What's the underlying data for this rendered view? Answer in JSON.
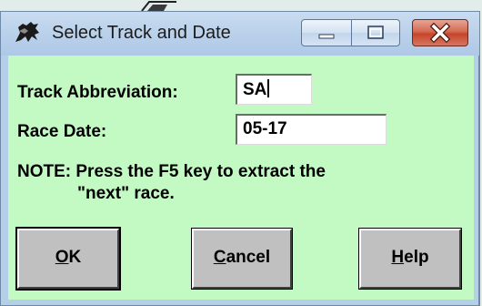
{
  "window": {
    "title": "Select Track and Date",
    "icon": "horse-icon",
    "controls": [
      "minimize",
      "maximize",
      "close"
    ]
  },
  "form": {
    "track_label": "Track Abbreviation:",
    "track_value": "SA",
    "date_label": "Race Date:",
    "date_value": "05-17",
    "note_line1": "NOTE: Press the F5 key to extract the",
    "note_line2": "\"next\" race."
  },
  "buttons": {
    "ok": {
      "mnemonic": "O",
      "rest": "K"
    },
    "cancel": {
      "mnemonic": "C",
      "rest": "ancel"
    },
    "help": {
      "mnemonic": "H",
      "rest": "elp"
    }
  },
  "colors": {
    "client_background": "#c3f9c3",
    "close_button": "#c6452c",
    "titlebar": "#b9d0ea"
  }
}
